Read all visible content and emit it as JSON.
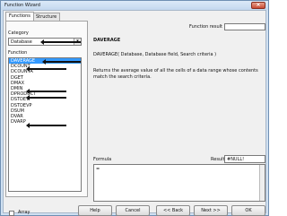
{
  "window": {
    "title": "Function Wizard",
    "close_glyph": "×"
  },
  "tabs": {
    "functions": "Functions",
    "structure": "Structure"
  },
  "left": {
    "category_label": "Category",
    "category_value": "Database",
    "function_label": "Function",
    "functions": [
      "DAVERAGE",
      "DCOUNT",
      "DCOUNTA",
      "DGET",
      "DMAX",
      "DMIN",
      "DPRODUCT",
      "DSTDEV",
      "DSTDEVP",
      "DSUM",
      "DVAR",
      "DVARP"
    ],
    "selected_index": 0,
    "array_label": "Array"
  },
  "right": {
    "function_result_label": "Function result",
    "function_result_value": "",
    "name": "DAVERAGE",
    "syntax": "DAVERAGE( Database, Database field, Search criteria )",
    "description": "Returns the average value of all the cells of a data range whose contents match the search criteria.",
    "formula_label": "Formula",
    "result_label": "Result",
    "result_value": "#NULL!",
    "formula_text": "="
  },
  "buttons": {
    "help": "Help",
    "cancel": "Cancel",
    "back": "<< Back",
    "next": "Next >>",
    "ok": "OK"
  },
  "icons": {
    "annotation_arrow": "arrow-left-icon",
    "dropdown": "chevron-down-icon"
  }
}
